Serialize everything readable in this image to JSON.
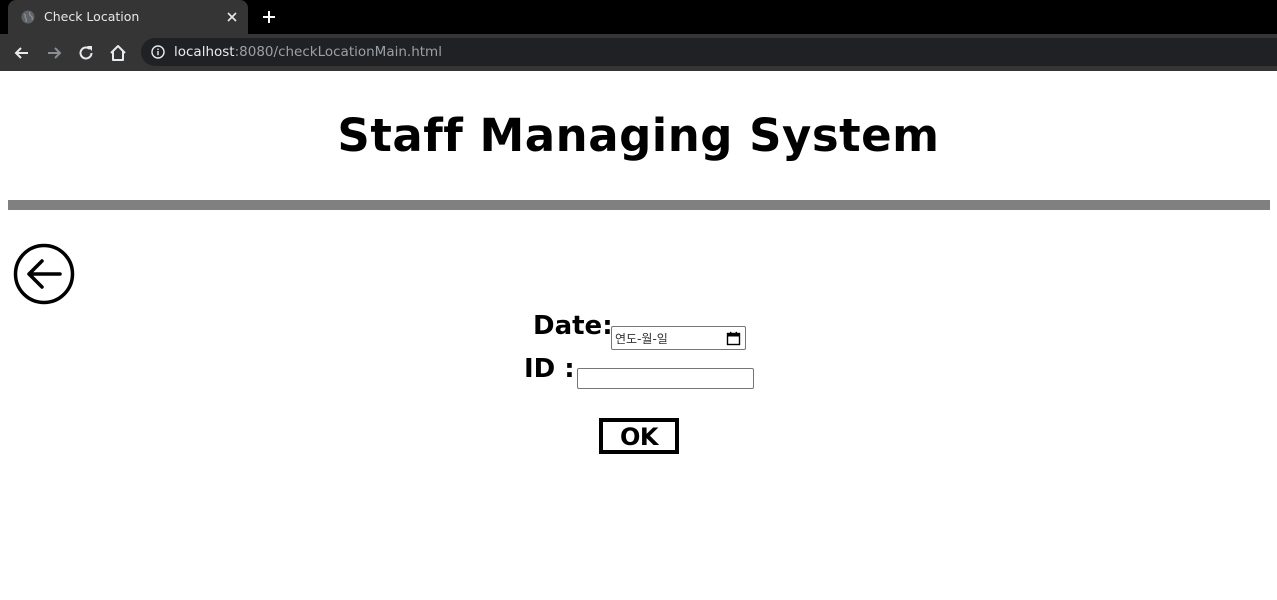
{
  "browser": {
    "tab_title": "Check Location",
    "url_host": "localhost",
    "url_rest": ":8080/checkLocationMain.html"
  },
  "page": {
    "title": "Staff Managing System",
    "form": {
      "date_label": "Date:",
      "date_placeholder": "연도-월-일",
      "id_label": "ID :",
      "id_value": ""
    },
    "ok_button": "OK"
  },
  "colors": {
    "divider": "#808080",
    "chrome_dark": "#353535"
  },
  "icons": {
    "back": "arrow-left-circle-icon",
    "calendar": "calendar-icon"
  }
}
